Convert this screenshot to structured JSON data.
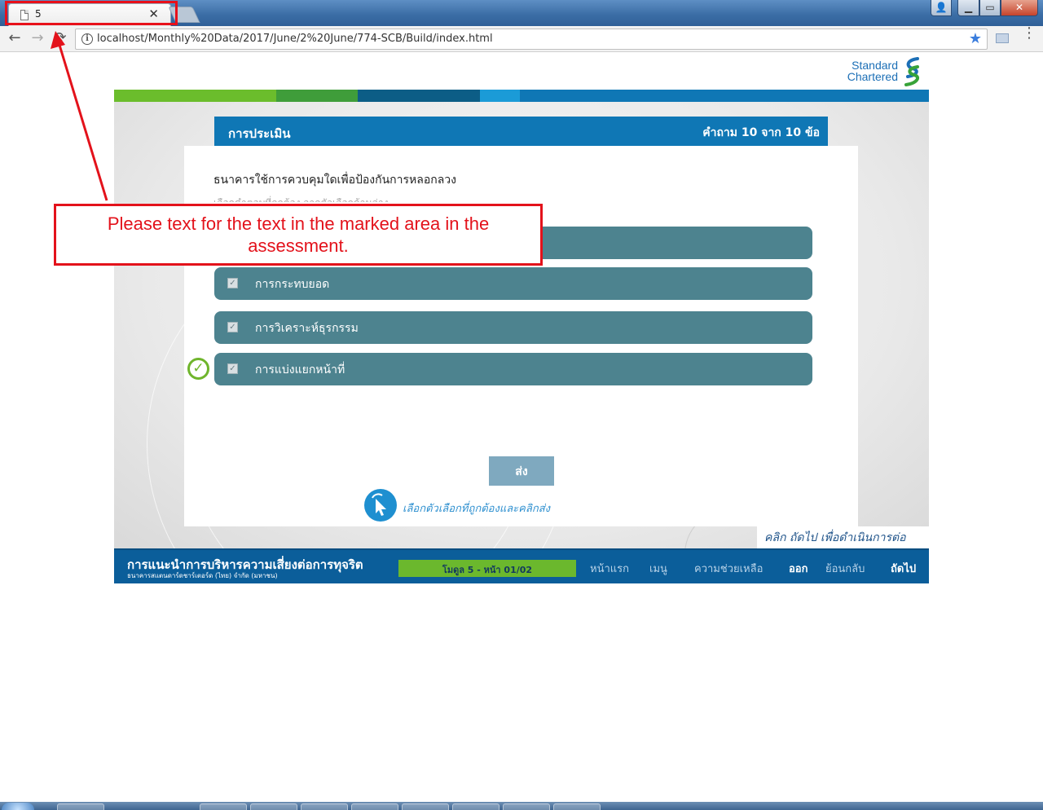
{
  "browser": {
    "tab_title": "5",
    "tab_close": "✕",
    "url": "localhost/Monthly%20Data/2017/June/2%20June/774-SCB/Build/index.html",
    "back": "←",
    "forward": "→",
    "reload": "⟳",
    "info": "i",
    "star": "★",
    "menu": "⋮",
    "window_user": "👤",
    "window_min": "▁",
    "window_max": "▭",
    "window_close": "✕"
  },
  "logo": {
    "line1": "Standard",
    "line2": "Chartered",
    "colors": [
      "#1c6fb6",
      "#38a339"
    ]
  },
  "band_colors": [
    "#6bbd2c",
    "#3f9d3a",
    "#0c5d86",
    "#1b9bd7",
    "#0f77b5"
  ],
  "assessment": {
    "title": "การประเมิน",
    "counter": "คำถาม 10 จาก 10 ข้อ",
    "question": "ธนาคารใช้การควบคุมใดเพื่อป้องกันการหลอกลวง",
    "question_faded": "เลือกคำตอบที่ถูกต้อง จากตัวเลือกด้านล่าง",
    "options": [
      {
        "label": "",
        "checked": true
      },
      {
        "label": "การกระทบยอด",
        "checked": true
      },
      {
        "label": "การวิเคราะห์ธุรกรรม",
        "checked": true
      },
      {
        "label": "การแบ่งแยกหน้าที่",
        "checked": true
      }
    ],
    "check_mark": "✓",
    "correct_mark": "✓",
    "submit": "ส่ง",
    "hint": "เลือกตัวเลือกที่ถูกต้องและคลิกส่ง",
    "continue_hint": "คลิก ถัดไป เพื่อดำเนินการต่อ"
  },
  "footer": {
    "title": "การแนะนำการบริหารความเสี่ยงต่อการทุจริต",
    "subtitle": "ธนาคารสแตนดาร์ดชาร์เตอร์ด (ไทย) จำกัด (มหาชน)",
    "progress_text": "โมดูล 5 - หน้า 01/02",
    "progress_fraction": 1.0,
    "nav": {
      "home": "หน้าแรก",
      "menu": "เมนู",
      "help": "ความช่วยเหลือ",
      "exit": "ออก",
      "back": "ย้อนกลับ",
      "next": "ถัดไป"
    }
  },
  "annotation": {
    "text": "Please text for the text in the marked area in the assessment.",
    "color": "#e3121b"
  }
}
